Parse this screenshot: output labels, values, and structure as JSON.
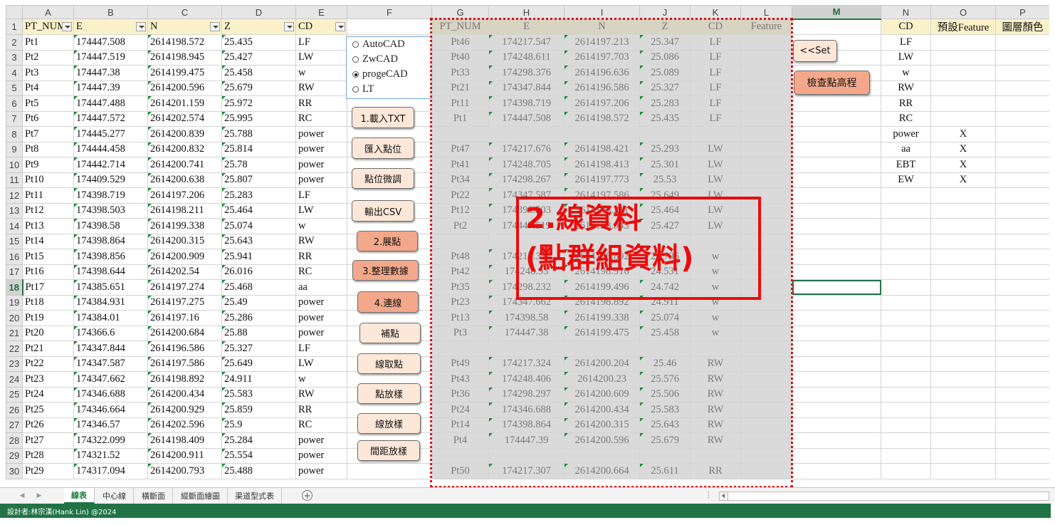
{
  "columns": [
    "A",
    "B",
    "C",
    "D",
    "E",
    "F",
    "G",
    "H",
    "I",
    "J",
    "K",
    "L",
    "M",
    "N",
    "O",
    "P"
  ],
  "selected_column": "M",
  "selected_row": 18,
  "header_row": {
    "A": "PT_NUM",
    "B": "E",
    "C": "N",
    "D": "Z",
    "E": "CD",
    "F": "",
    "G": "PT_NUM",
    "H": "E",
    "I": "N",
    "J": "Z",
    "K": "CD",
    "L": "Feature",
    "M": "",
    "N": "CD",
    "O": "預設Feature",
    "P": "圖層顏色"
  },
  "rows": [
    {
      "r": 2,
      "A": "Pt1",
      "B": "174447.508",
      "C": "2614198.572",
      "D": "25.435",
      "E": "LF",
      "G": "Pt46",
      "H": "174217.547",
      "I": "2614197.213",
      "J": "25.347",
      "K": "LF",
      "N": "LF",
      "O": ""
    },
    {
      "r": 3,
      "A": "Pt2",
      "B": "174447.519",
      "C": "2614198.945",
      "D": "25.427",
      "E": "LW",
      "G": "Pt40",
      "H": "174248.611",
      "I": "2614197.703",
      "J": "25.086",
      "K": "LF",
      "N": "LW",
      "O": ""
    },
    {
      "r": 4,
      "A": "Pt3",
      "B": "174447.38",
      "C": "2614199.475",
      "D": "25.458",
      "E": "w",
      "G": "Pt33",
      "H": "174298.376",
      "I": "2614196.636",
      "J": "25.089",
      "K": "LF",
      "N": "w",
      "O": ""
    },
    {
      "r": 5,
      "A": "Pt4",
      "B": "174447.39",
      "C": "2614200.596",
      "D": "25.679",
      "E": "RW",
      "G": "Pt21",
      "H": "174347.844",
      "I": "2614196.586",
      "J": "25.327",
      "K": "LF",
      "N": "RW",
      "O": ""
    },
    {
      "r": 6,
      "A": "Pt5",
      "B": "174447.488",
      "C": "2614201.159",
      "D": "25.972",
      "E": "RR",
      "G": "Pt11",
      "H": "174398.719",
      "I": "2614197.206",
      "J": "25.283",
      "K": "LF",
      "N": "RR",
      "O": ""
    },
    {
      "r": 7,
      "A": "Pt6",
      "B": "174447.572",
      "C": "2614202.574",
      "D": "25.995",
      "E": "RC",
      "G": "Pt1",
      "H": "174447.508",
      "I": "2614198.572",
      "J": "25.435",
      "K": "LF",
      "N": "RC",
      "O": ""
    },
    {
      "r": 8,
      "A": "Pt7",
      "B": "174445.277",
      "C": "2614200.839",
      "D": "25.788",
      "E": "power",
      "G": "",
      "H": "",
      "I": "",
      "J": "",
      "K": "",
      "N": "power",
      "O": "X"
    },
    {
      "r": 9,
      "A": "Pt8",
      "B": "174444.458",
      "C": "2614200.832",
      "D": "25.814",
      "E": "power",
      "G": "Pt47",
      "H": "174217.676",
      "I": "2614198.421",
      "J": "25.293",
      "K": "LW",
      "N": "aa",
      "O": "X"
    },
    {
      "r": 10,
      "A": "Pt9",
      "B": "174442.714",
      "C": "2614200.741",
      "D": "25.78",
      "E": "power",
      "G": "Pt41",
      "H": "174248.705",
      "I": "2614198.413",
      "J": "25.301",
      "K": "LW",
      "N": "EBT",
      "O": "X"
    },
    {
      "r": 11,
      "A": "Pt10",
      "B": "174409.529",
      "C": "2614200.638",
      "D": "25.807",
      "E": "power",
      "G": "Pt34",
      "H": "174298.267",
      "I": "2614197.773",
      "J": "25.53",
      "K": "LW",
      "N": "EW",
      "O": "X"
    },
    {
      "r": 12,
      "A": "Pt11",
      "B": "174398.719",
      "C": "2614197.206",
      "D": "25.283",
      "E": "LF",
      "G": "Pt22",
      "H": "174347.587",
      "I": "2614197.586",
      "J": "25.649",
      "K": "LW",
      "N": "",
      "O": ""
    },
    {
      "r": 13,
      "A": "Pt12",
      "B": "174398.503",
      "C": "2614198.211",
      "D": "25.464",
      "E": "LW",
      "G": "Pt12",
      "H": "174398.503",
      "I": "2614198.211",
      "J": "25.464",
      "K": "LW",
      "N": "",
      "O": ""
    },
    {
      "r": 14,
      "A": "Pt13",
      "B": "174398.58",
      "C": "2614199.338",
      "D": "25.074",
      "E": "w",
      "G": "Pt2",
      "H": "174447.519",
      "I": "2614198.945",
      "J": "25.427",
      "K": "LW",
      "N": "",
      "O": ""
    },
    {
      "r": 15,
      "A": "Pt14",
      "B": "174398.864",
      "C": "2614200.315",
      "D": "25.643",
      "E": "RW",
      "G": "",
      "H": "",
      "I": "",
      "J": "",
      "K": "",
      "N": "",
      "O": ""
    },
    {
      "r": 16,
      "A": "Pt15",
      "B": "174398.856",
      "C": "2614200.909",
      "D": "25.941",
      "E": "RR",
      "G": "Pt48",
      "H": "174217.324",
      "I": "2614198.892",
      "J": "24.795",
      "K": "w",
      "N": "",
      "O": ""
    },
    {
      "r": 17,
      "A": "Pt16",
      "B": "174398.644",
      "C": "2614202.54",
      "D": "26.016",
      "E": "RC",
      "G": "Pt42",
      "H": "174248.93",
      "I": "2614198.916",
      "J": "24.531",
      "K": "w",
      "N": "",
      "O": ""
    },
    {
      "r": 18,
      "A": "Pt17",
      "B": "174385.651",
      "C": "2614197.274",
      "D": "25.468",
      "E": "aa",
      "G": "Pt35",
      "H": "174298.232",
      "I": "2614199.496",
      "J": "24.742",
      "K": "w",
      "N": "",
      "O": ""
    },
    {
      "r": 19,
      "A": "Pt18",
      "B": "174384.931",
      "C": "2614197.275",
      "D": "25.49",
      "E": "power",
      "G": "Pt23",
      "H": "174347.662",
      "I": "2614198.892",
      "J": "24.911",
      "K": "w",
      "N": "",
      "O": ""
    },
    {
      "r": 20,
      "A": "Pt19",
      "B": "174384.01",
      "C": "2614197.16",
      "D": "25.286",
      "E": "power",
      "G": "Pt13",
      "H": "174398.58",
      "I": "2614199.338",
      "J": "25.074",
      "K": "w",
      "N": "",
      "O": ""
    },
    {
      "r": 21,
      "A": "Pt20",
      "B": "174366.6",
      "C": "2614200.684",
      "D": "25.88",
      "E": "power",
      "G": "Pt3",
      "H": "174447.38",
      "I": "2614199.475",
      "J": "25.458",
      "K": "w",
      "N": "",
      "O": ""
    },
    {
      "r": 22,
      "A": "Pt21",
      "B": "174347.844",
      "C": "2614196.586",
      "D": "25.327",
      "E": "LF",
      "G": "",
      "H": "",
      "I": "",
      "J": "",
      "K": "",
      "N": "",
      "O": ""
    },
    {
      "r": 23,
      "A": "Pt22",
      "B": "174347.587",
      "C": "2614197.586",
      "D": "25.649",
      "E": "LW",
      "G": "Pt49",
      "H": "174217.324",
      "I": "2614200.204",
      "J": "25.46",
      "K": "RW",
      "N": "",
      "O": ""
    },
    {
      "r": 24,
      "A": "Pt23",
      "B": "174347.662",
      "C": "2614198.892",
      "D": "24.911",
      "E": "w",
      "G": "Pt43",
      "H": "174248.406",
      "I": "2614200.23",
      "J": "25.576",
      "K": "RW",
      "N": "",
      "O": ""
    },
    {
      "r": 25,
      "A": "Pt24",
      "B": "174346.688",
      "C": "2614200.434",
      "D": "25.583",
      "E": "RW",
      "G": "Pt36",
      "H": "174298.297",
      "I": "2614200.609",
      "J": "25.506",
      "K": "RW",
      "N": "",
      "O": ""
    },
    {
      "r": 26,
      "A": "Pt25",
      "B": "174346.664",
      "C": "2614200.929",
      "D": "25.859",
      "E": "RR",
      "G": "Pt24",
      "H": "174346.688",
      "I": "2614200.434",
      "J": "25.583",
      "K": "RW",
      "N": "",
      "O": ""
    },
    {
      "r": 27,
      "A": "Pt26",
      "B": "174346.57",
      "C": "2614202.596",
      "D": "25.9",
      "E": "RC",
      "G": "Pt14",
      "H": "174398.864",
      "I": "2614200.315",
      "J": "25.643",
      "K": "RW",
      "N": "",
      "O": ""
    },
    {
      "r": 28,
      "A": "Pt27",
      "B": "174322.099",
      "C": "2614198.409",
      "D": "25.284",
      "E": "power",
      "G": "Pt4",
      "H": "174447.39",
      "I": "2614200.596",
      "J": "25.679",
      "K": "RW",
      "N": "",
      "O": ""
    },
    {
      "r": 29,
      "A": "Pt28",
      "B": "174321.52",
      "C": "2614200.911",
      "D": "25.554",
      "E": "power",
      "G": "",
      "H": "",
      "I": "",
      "J": "",
      "K": "",
      "N": "",
      "O": ""
    },
    {
      "r": 30,
      "A": "Pt29",
      "B": "174317.094",
      "C": "2614200.793",
      "D": "25.488",
      "E": "power",
      "G": "Pt50",
      "H": "174217.307",
      "I": "2614200.664",
      "J": "25.611",
      "K": "RR",
      "N": "",
      "O": ""
    }
  ],
  "cad_options": {
    "items": [
      {
        "label": "AutoCAD",
        "selected": false
      },
      {
        "label": "ZwCAD",
        "selected": false
      },
      {
        "label": "progeCAD",
        "selected": true
      },
      {
        "label": "LT",
        "selected": false
      }
    ]
  },
  "buttons": {
    "load_txt": "1.載入TXT",
    "import_points": "匯入點位",
    "adjust_points": "點位微調",
    "export_csv": "輸出CSV",
    "expand_points": "2.展點",
    "organize_data": "3.整理數據",
    "connect_lines": "4.連線",
    "fill_points": "補點",
    "line_pick_points": "線取點",
    "point_stakeout": "點放樣",
    "line_stakeout": "線放樣",
    "spacing_stakeout": "間距放樣",
    "set": "<<Set",
    "check_elevation": "檢查點高程"
  },
  "annotation": {
    "line1": "2.線資料",
    "line2": "(點群組資料)"
  },
  "sheet_tabs": [
    {
      "label": "線表",
      "active": true
    },
    {
      "label": "中心線",
      "active": false
    },
    {
      "label": "橫斷面",
      "active": false
    },
    {
      "label": "縱斷面繪圖",
      "active": false
    },
    {
      "label": "渠道型式表",
      "active": false
    }
  ],
  "status_bar": {
    "text": "設計者:林宗漢(Hank Lin) @2024"
  },
  "colors": {
    "header_fill": "#fbf1c9",
    "grey_fill": "#dadada",
    "button_light": "#fde7d8",
    "button_dark": "#f4a88b",
    "annotation_red": "#ea0c0c",
    "excel_green": "#217346"
  }
}
